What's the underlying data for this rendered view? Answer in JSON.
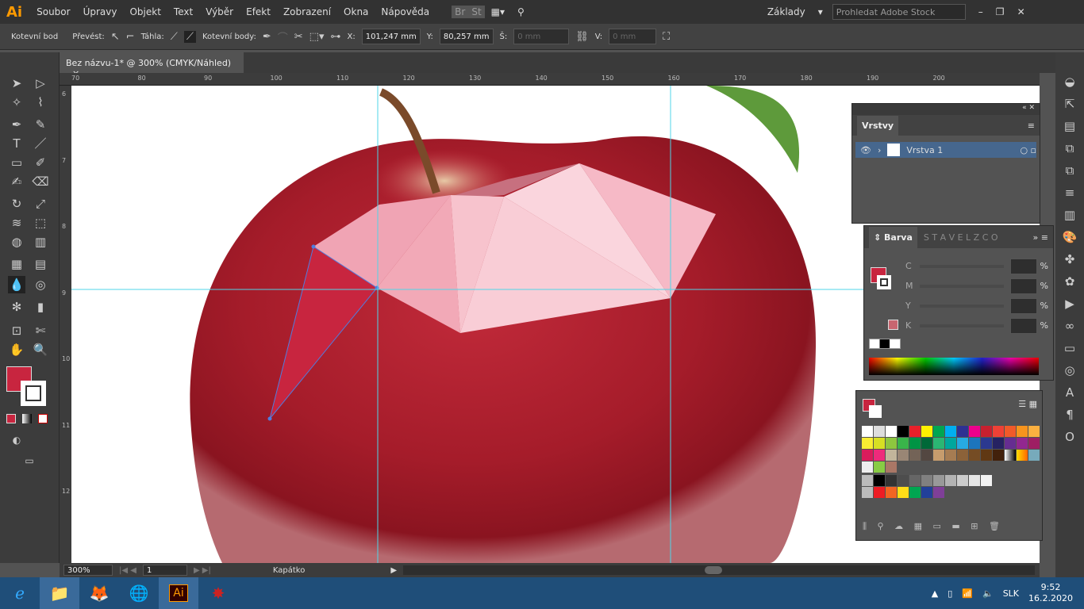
{
  "app": {
    "logo": "Ai",
    "menu": [
      "Soubor",
      "Úpravy",
      "Objekt",
      "Text",
      "Výběr",
      "Efekt",
      "Zobrazení",
      "Okna",
      "Nápověda"
    ],
    "bridge": "Br",
    "stock": "St",
    "workspace": "Základy",
    "search_placeholder": "Prohledat Adobe Stock"
  },
  "control": {
    "mode": "Kotevní bod",
    "convert": "Převést:",
    "handles": "Táhla:",
    "anchors": "Kotevní body:",
    "x_label": "X:",
    "x": "101,247 mm",
    "y_label": "Y:",
    "y": "80,257 mm",
    "w_label": "Š:",
    "w": "0 mm",
    "h_label": "V:",
    "h": "0 mm"
  },
  "document": {
    "tab": "Bez názvu-1* @ 300% (CMYK/Náhled)",
    "close": "×"
  },
  "ruler": {
    "top": [
      "70",
      "80",
      "90",
      "100",
      "110",
      "120",
      "130",
      "140",
      "150",
      "160",
      "170",
      "180",
      "190",
      "200"
    ],
    "left": [
      "6",
      "7",
      "8",
      "9",
      "10",
      "11",
      "12"
    ]
  },
  "status": {
    "zoom": "300%",
    "page": "1",
    "tool": "Kapátko"
  },
  "layers": {
    "title": "Vrstvy",
    "layer": "Vrstva 1"
  },
  "color_panel": {
    "title": "Barva",
    "channels": [
      "C",
      "M",
      "Y",
      "K"
    ],
    "unit": "%",
    "fill": "#c8253f"
  },
  "taskbar": {
    "lang": "SLK",
    "time": "9:52",
    "date": "16.2.2020"
  },
  "colors": {
    "accent": "#ff9a00",
    "fill": "#c8253f",
    "guide": "#4fd6e8"
  }
}
